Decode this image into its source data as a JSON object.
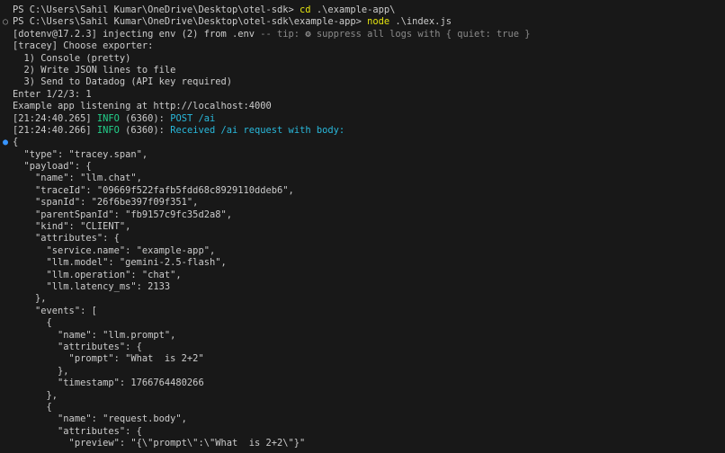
{
  "colors": {
    "background": "#181818",
    "text": "#cccccc",
    "command": "#e5e510",
    "info": "#23d18b",
    "cyan": "#29b8db",
    "dim": "#8a8a8a",
    "prompt_marker_done": "#9a9a9a",
    "prompt_marker_active": "#3794ff"
  },
  "icons": {
    "prompt_marker_done": "hollow-circle",
    "prompt_marker_active": "filled-circle",
    "tip_gear": "gear"
  },
  "terminal": {
    "line1": {
      "prompt": "PS C:\\Users\\Sahil Kumar\\OneDrive\\Desktop\\otel-sdk> ",
      "command": "cd",
      "arg": " .\\example-app\\"
    },
    "line2": {
      "marker": "○",
      "prompt": "PS C:\\Users\\Sahil Kumar\\OneDrive\\Desktop\\otel-sdk\\example-app> ",
      "command": "node",
      "arg": " .\\index.js"
    },
    "dotenv": {
      "text": "[dotenv@17.2.3] injecting env (2) from .env",
      "tip_prefix": " -- tip: ",
      "gear": "⚙",
      "tip_text": " suppress all logs with { quiet: true }"
    },
    "tracey_lines": [
      "[tracey] Choose exporter:",
      "  1) Console (pretty)",
      "  2) Write JSON lines to file",
      "  3) Send to Datadog (API key required)",
      "Enter 1/2/3: 1",
      "Example app listening at http://localhost:4000"
    ],
    "log1": {
      "time": "[21:24:40.265] ",
      "level": "INFO",
      "pid": " (6360): ",
      "msg": "POST /ai"
    },
    "log2": {
      "time": "[21:24:40.266] ",
      "level": "INFO",
      "pid": " (6360): ",
      "msg": "Received /ai request with body:"
    },
    "body_marker": "●",
    "json_lines": [
      "{",
      "  \"type\": \"tracey.span\",",
      "  \"payload\": {",
      "    \"name\": \"llm.chat\",",
      "    \"traceId\": \"09669f522fafb5fdd68c8929110ddeb6\",",
      "    \"spanId\": \"26f6be397f09f351\",",
      "    \"parentSpanId\": \"fb9157c9fc35d2a8\",",
      "    \"kind\": \"CLIENT\",",
      "    \"attributes\": {",
      "      \"service.name\": \"example-app\",",
      "      \"llm.model\": \"gemini-2.5-flash\",",
      "      \"llm.operation\": \"chat\",",
      "      \"llm.latency_ms\": 2133",
      "    },",
      "    \"events\": [",
      "      {",
      "        \"name\": \"llm.prompt\",",
      "        \"attributes\": {",
      "          \"prompt\": \"What  is 2+2\"",
      "        },",
      "        \"timestamp\": 1766764480266",
      "      },",
      "      {",
      "        \"name\": \"request.body\",",
      "        \"attributes\": {",
      "          \"preview\": \"{\\\"prompt\\\":\\\"What  is 2+2\\\"}\""
    ]
  }
}
